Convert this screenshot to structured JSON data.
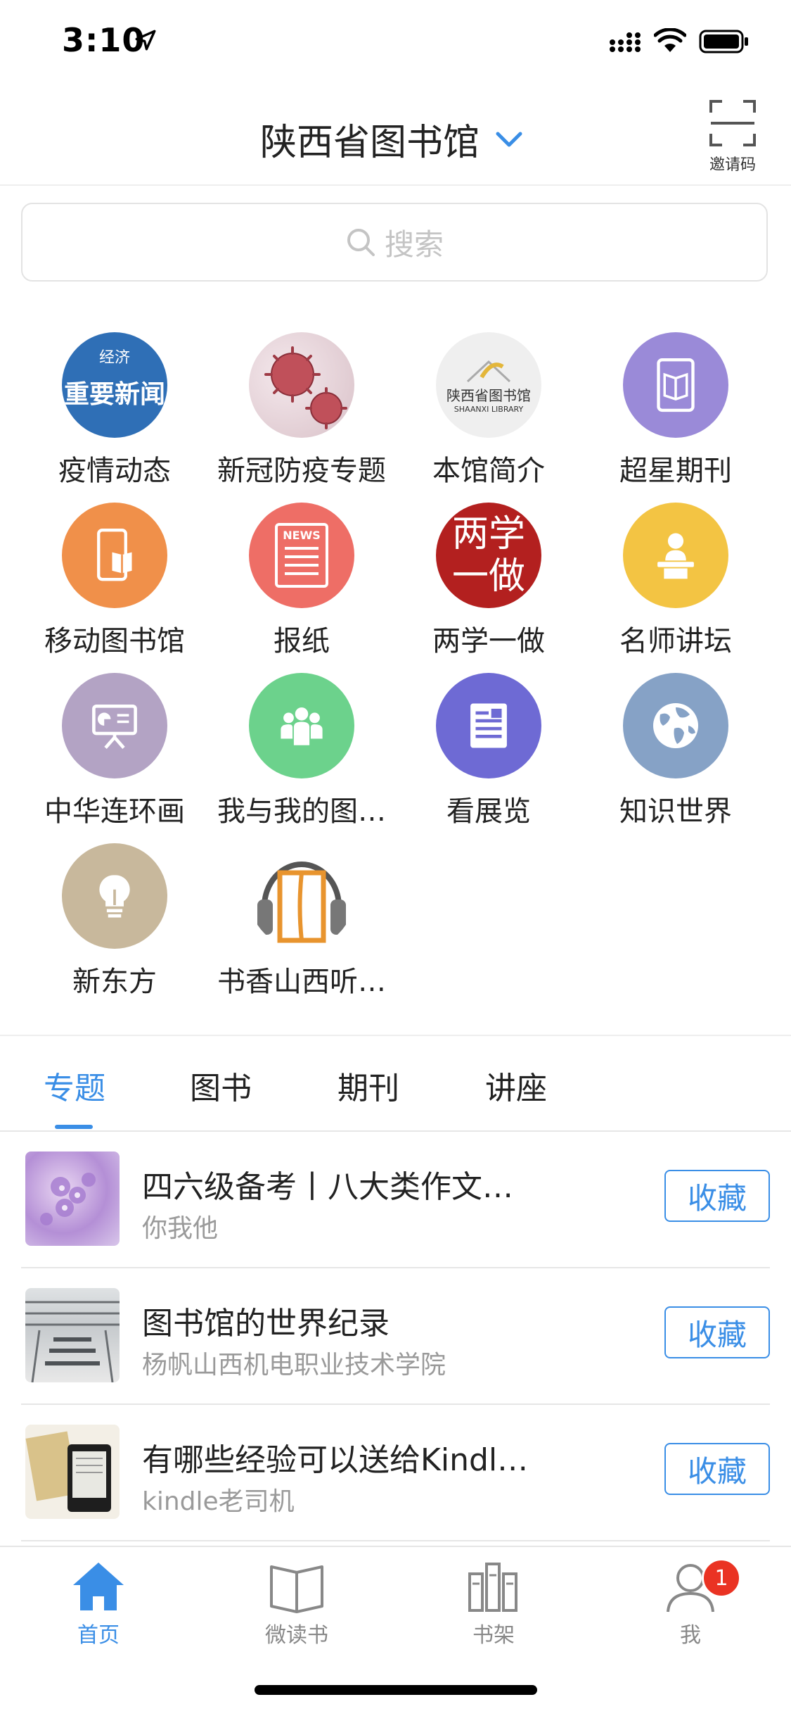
{
  "status_bar": {
    "time": "3:10"
  },
  "header": {
    "title": "陕西省图书馆",
    "invite_label": "邀请码"
  },
  "search": {
    "placeholder": "搜索"
  },
  "grid": {
    "items": [
      {
        "label": "疫情动态",
        "icon": "news-badge-icon",
        "color": "#2f6fb6",
        "badge_text": "重要新闻",
        "seal": "经济"
      },
      {
        "label": "新冠防疫专题",
        "icon": "virus-icon",
        "color": "#e9d9de"
      },
      {
        "label": "本馆简介",
        "icon": "library-logo-icon",
        "color": "#efefef",
        "logo_text": "陕西省图书馆",
        "logo_en": "SHAANXI LIBRARY"
      },
      {
        "label": "超星期刊",
        "icon": "tablet-book-icon",
        "color": "#9a8ad8"
      },
      {
        "label": "移动图书馆",
        "icon": "mobile-book-icon",
        "color": "#f0904a"
      },
      {
        "label": "报纸",
        "icon": "newspaper-icon",
        "color": "#ee6e66",
        "news_text": "NEWS"
      },
      {
        "label": "两学一做",
        "icon": "calligraphy-icon",
        "color": "#b3201f",
        "calligraphy": "两学一做"
      },
      {
        "label": "名师讲坛",
        "icon": "lecturer-icon",
        "color": "#f3c443"
      },
      {
        "label": "中华连环画",
        "icon": "presentation-icon",
        "color": "#b3a3c4"
      },
      {
        "label": "我与我的图…",
        "icon": "people-icon",
        "color": "#6cd28c"
      },
      {
        "label": "看展览",
        "icon": "exhibition-icon",
        "color": "#6e6ad4"
      },
      {
        "label": "知识世界",
        "icon": "globe-icon",
        "color": "#86a2c6"
      },
      {
        "label": "新东方",
        "icon": "lightbulb-icon",
        "color": "#c8b89c"
      },
      {
        "label": "书香山西听…",
        "icon": "headphone-book-icon",
        "color": "#ffffff"
      }
    ]
  },
  "tabs": [
    {
      "label": "专题",
      "active": true
    },
    {
      "label": "图书",
      "active": false
    },
    {
      "label": "期刊",
      "active": false
    },
    {
      "label": "讲座",
      "active": false
    }
  ],
  "list": [
    {
      "title": "四六级备考丨八大类作文…",
      "subtitle": "你我他",
      "button": "收藏",
      "thumb": "lilac-flower-image"
    },
    {
      "title": "图书馆的世界纪录",
      "subtitle": "杨帆山西机电职业技术学院",
      "button": "收藏",
      "thumb": "library-interior-image"
    },
    {
      "title": "有哪些经验可以送给Kindl…",
      "subtitle": "kindle老司机",
      "button": "收藏",
      "thumb": "kindle-device-image"
    }
  ],
  "bottom_nav": [
    {
      "label": "首页",
      "icon": "home-icon",
      "active": true
    },
    {
      "label": "微读书",
      "icon": "open-book-icon",
      "active": false
    },
    {
      "label": "书架",
      "icon": "bookshelf-icon",
      "active": false
    },
    {
      "label": "我",
      "icon": "user-icon",
      "active": false,
      "badge": "1"
    }
  ],
  "colors": {
    "accent": "#3a8ee6",
    "badge": "#ea3323",
    "divider": "#e6e6e6"
  }
}
